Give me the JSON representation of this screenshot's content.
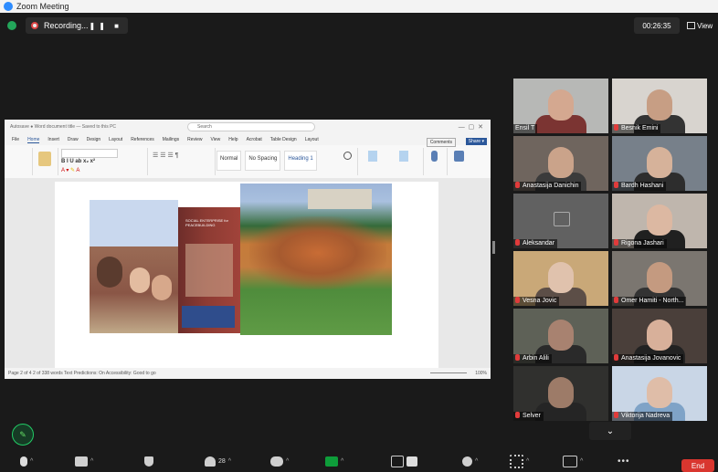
{
  "window": {
    "title": "Zoom Meeting"
  },
  "topbar": {
    "recording": "Recording...",
    "recording_controls": "❚❚ ■",
    "timer": "00:26:35",
    "view": "View"
  },
  "word": {
    "title": "Autosave  ●  Word document title — Saved to this PC",
    "search": "Search",
    "tabs": [
      "File",
      "Home",
      "Insert",
      "Draw",
      "Design",
      "Layout",
      "References",
      "Mailings",
      "Review",
      "View",
      "Help",
      "Acrobat",
      "Table Design",
      "Layout"
    ],
    "styles": [
      "Normal",
      "No Spacing",
      "Heading 1"
    ],
    "ribbon_groups": [
      "Undo",
      "Clipboard",
      "Font",
      "Paragraph",
      "Styles",
      "Adobe Acrobat",
      "Voice",
      "Editor"
    ],
    "status": "Page 2 of 4     2 of 338 words     Text Predictions: On     Accessibility: Good to go",
    "zoom": "100%",
    "photo_text": "SOCIAL ENTERPRISE for PEACEBUILDING"
  },
  "participants": [
    {
      "name": "Ensil T",
      "highlight": true,
      "muted": false,
      "bg": "#b7b8b6",
      "skin": "#d4a890",
      "shirt": "#7b3432"
    },
    {
      "name": "Besnik Emini",
      "muted": true,
      "bg": "#d8d4cf",
      "skin": "#c79e84",
      "shirt": "#333"
    },
    {
      "name": "Anastasija Danichin",
      "muted": true,
      "bg": "#6f655e",
      "skin": "#caa38a",
      "shirt": "#3b3b3b"
    },
    {
      "name": "Bardh Hashani",
      "muted": true,
      "bg": "#77808a",
      "skin": "#d6b29a",
      "shirt": "#2d2d2d"
    },
    {
      "name": "Aleksandar",
      "muted": true,
      "bg": "#616161",
      "avatar": true
    },
    {
      "name": "Rigona Jashari",
      "muted": true,
      "bg": "#bfb6ad",
      "skin": "#dcb8a2",
      "shirt": "#202020"
    },
    {
      "name": "Vesna Jovic",
      "muted": true,
      "bg": "#c9a878",
      "skin": "#e0c2ad",
      "shirt": "#5c4e47"
    },
    {
      "name": "Omer Hamiti - North...",
      "muted": true,
      "bg": "#7b7670",
      "skin": "#c49a80",
      "shirt": "#333"
    },
    {
      "name": "Arbin Alili",
      "muted": true,
      "bg": "#5e6157",
      "skin": "#a88270",
      "shirt": "#2a2a2a"
    },
    {
      "name": "Anastasija Jovanovic",
      "muted": true,
      "bg": "#4a3f3a",
      "skin": "#d8b09a",
      "shirt": "#222"
    },
    {
      "name": "Selver",
      "muted": true,
      "bg": "#30302e",
      "skin": "#9d7b68",
      "shirt": "#252525"
    },
    {
      "name": "Viktorija Nadreva",
      "muted": true,
      "bg": "#c9d6e6",
      "skin": "#dfbda8",
      "shirt": "#7fa3c7"
    }
  ],
  "toolbar": {
    "participants_count": "28",
    "end": "End"
  }
}
